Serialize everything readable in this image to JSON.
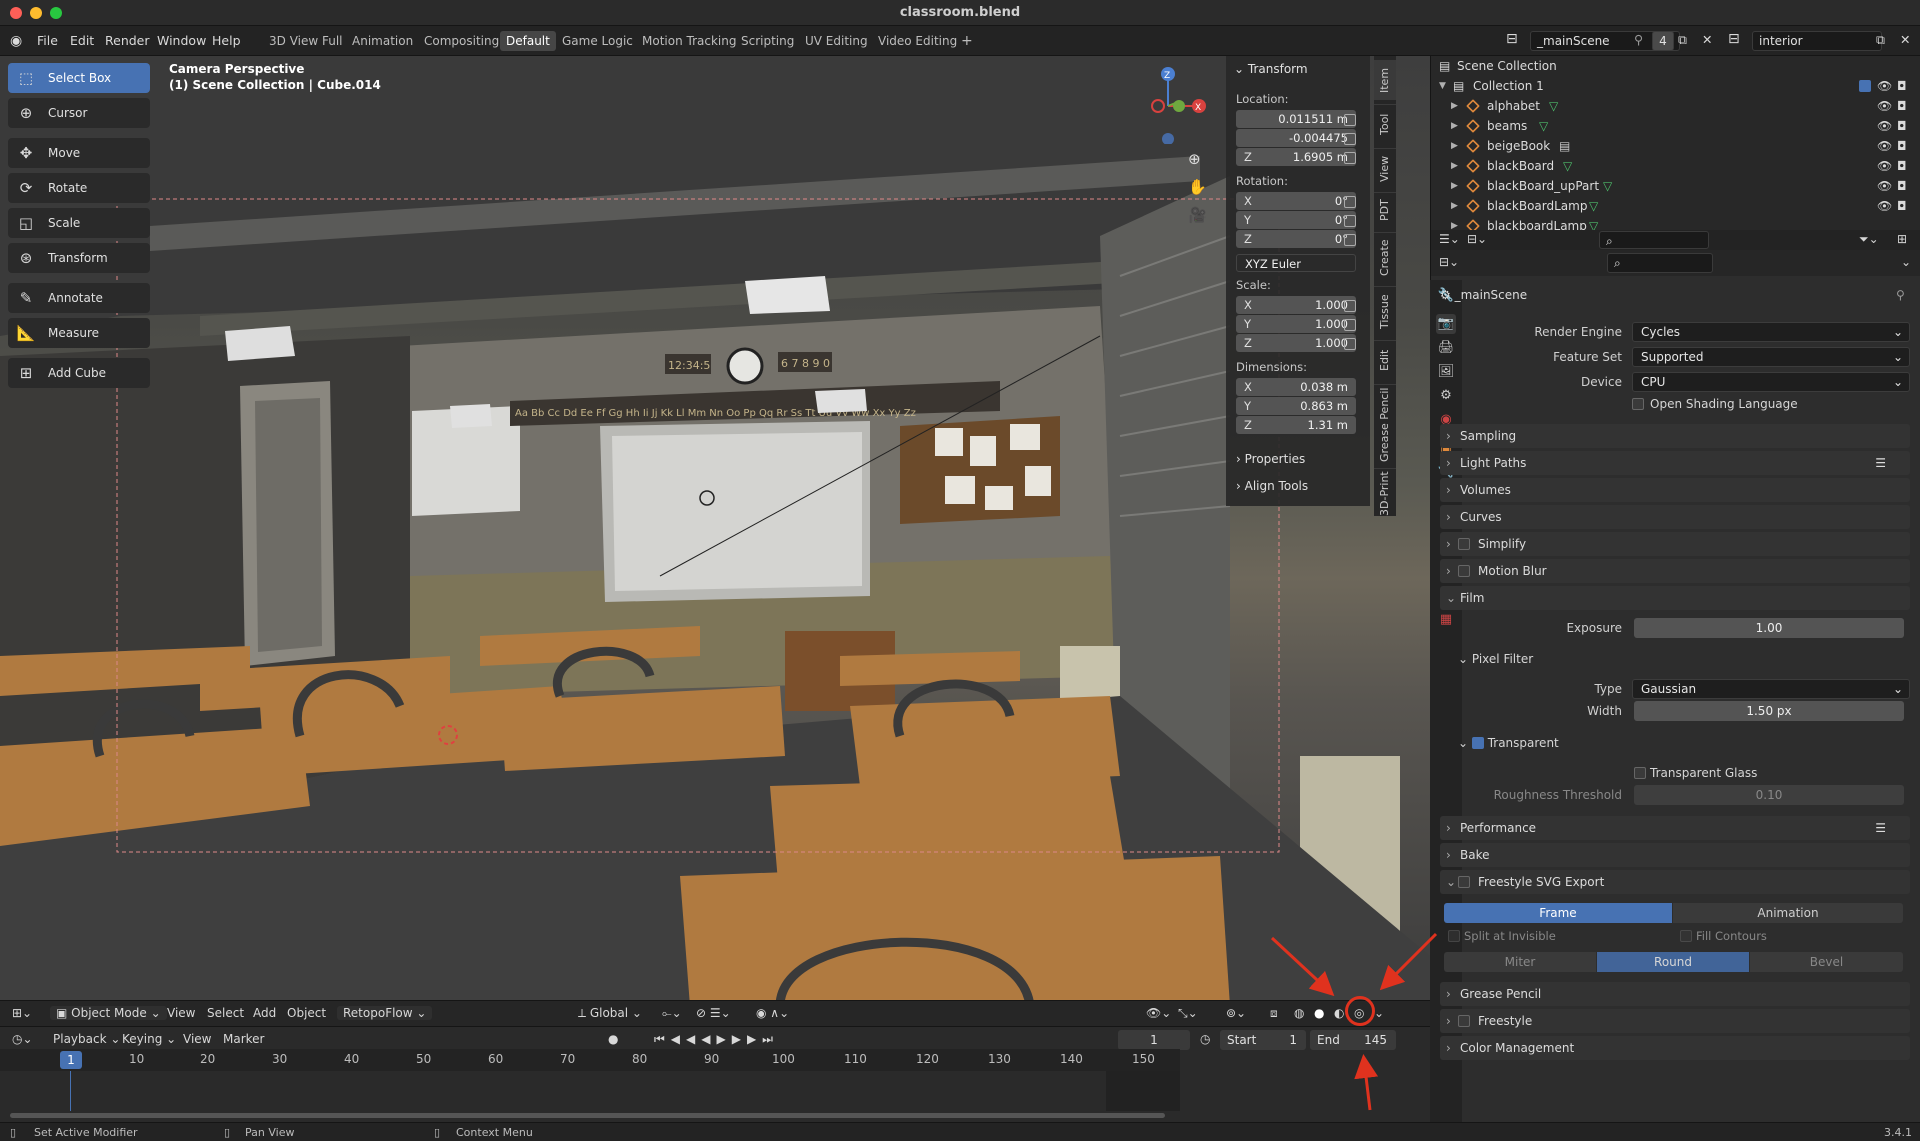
{
  "window": {
    "title": "classroom.blend"
  },
  "menubar": {
    "items": [
      "File",
      "Edit",
      "Render",
      "Window",
      "Help"
    ],
    "workspaces": [
      "3D View Full",
      "Animation",
      "Compositing",
      "Default",
      "Game Logic",
      "Motion Tracking",
      "Scripting",
      "UV Editing",
      "Video Editing"
    ],
    "active_workspace": "Default",
    "add_tab": "+",
    "scene_name": "_mainScene",
    "scene_users": "4",
    "view_layer": "interior"
  },
  "toolbar": {
    "tools": [
      "Select Box",
      "Cursor",
      "Move",
      "Rotate",
      "Scale",
      "Transform",
      "Annotate",
      "Measure",
      "Add Cube"
    ],
    "active": "Select Box"
  },
  "viewport": {
    "camera_label": "Camera Perspective",
    "object_label": "(1) Scene Collection | Cube.014",
    "clock_left": "12:34:5",
    "clock_right": "6 7 8 9 0",
    "alphabet": "Aa Bb Cc Dd Ee Ff Gg Hh Ii Jj Kk Ll Mm Nn Oo Pp Qq Rr Ss Tt Uu Vv Ww Xx Yy Zz",
    "gizmo": {
      "z": "Z",
      "x": "X"
    },
    "header": {
      "mode": "Object Mode",
      "menus": [
        "View",
        "Select",
        "Add",
        "Object",
        "RetopoFlow"
      ],
      "orientation": "Global"
    }
  },
  "npanel": {
    "title": "Transform",
    "location_label": "Location:",
    "location": {
      "x": "0.011511 m",
      "y": "-0.004475",
      "z": "1.6905 m"
    },
    "rotation_label": "Rotation:",
    "rotation": {
      "x": "0°",
      "y": "0°",
      "z": "0°"
    },
    "rotation_mode": "XYZ Euler",
    "scale_label": "Scale:",
    "scale": {
      "x": "1.000",
      "y": "1.000",
      "z": "1.000"
    },
    "dimensions_label": "Dimensions:",
    "dimensions": {
      "x": "0.038 m",
      "y": "0.863 m",
      "z": "1.31 m"
    },
    "axis": {
      "x": "X",
      "y": "Y",
      "z": "Z"
    },
    "collapsed": [
      "Properties",
      "Align Tools"
    ],
    "tabs": [
      "Item",
      "Tool",
      "View",
      "PDT",
      "Create",
      "Tissue",
      "Edit",
      "Grease Pencil",
      "3D-Print"
    ]
  },
  "timeline": {
    "menus": [
      "Playback",
      "Keying",
      "View",
      "Marker"
    ],
    "current_frame": "1",
    "start_label": "Start",
    "start": "1",
    "end_label": "End",
    "end": "145",
    "ruler": [
      "1",
      "10",
      "20",
      "30",
      "40",
      "50",
      "60",
      "70",
      "80",
      "90",
      "100",
      "110",
      "120",
      "130",
      "140",
      "150"
    ]
  },
  "statusbar": {
    "items": [
      "Set Active Modifier",
      "Pan View",
      "Context Menu"
    ],
    "version": "3.4.1"
  },
  "outliner": {
    "root": "Scene Collection",
    "collection": "Collection 1",
    "objects": [
      "alphabet",
      "beams",
      "beigeBook",
      "blackBoard",
      "blackBoard_upPart",
      "blackBoardLamp",
      "blackboardLamp"
    ]
  },
  "properties": {
    "scene_name": "_mainScene",
    "render_engine_label": "Render Engine",
    "render_engine": "Cycles",
    "feature_set_label": "Feature Set",
    "feature_set": "Supported",
    "device_label": "Device",
    "device": "CPU",
    "osl_label": "Open Shading Language",
    "sections": [
      "Sampling",
      "Light Paths",
      "Volumes",
      "Curves",
      "Simplify",
      "Motion Blur",
      "Film"
    ],
    "film": {
      "exposure_label": "Exposure",
      "exposure": "1.00",
      "pixel_filter": "Pixel Filter",
      "type_label": "Type",
      "type": "Gaussian",
      "width_label": "Width",
      "width": "1.50 px",
      "transparent": "Transparent",
      "transparent_glass": "Transparent Glass",
      "roughness_label": "Roughness Threshold",
      "roughness": "0.10"
    },
    "sections_after": [
      "Performance",
      "Bake",
      "Freestyle SVG Export"
    ],
    "svg_export": {
      "frame": "Frame",
      "animation": "Animation",
      "split": "Split at Invisible",
      "fill": "Fill Contours",
      "miter": "Miter",
      "round": "Round",
      "bevel": "Bevel"
    },
    "sections_end": [
      "Grease Pencil",
      "Freestyle",
      "Color Management"
    ]
  },
  "colors": {
    "accent": "#4772b3",
    "annotation": "#e0321e",
    "object_orange": "#e08a3c",
    "mesh_green": "#4dbd6a"
  }
}
